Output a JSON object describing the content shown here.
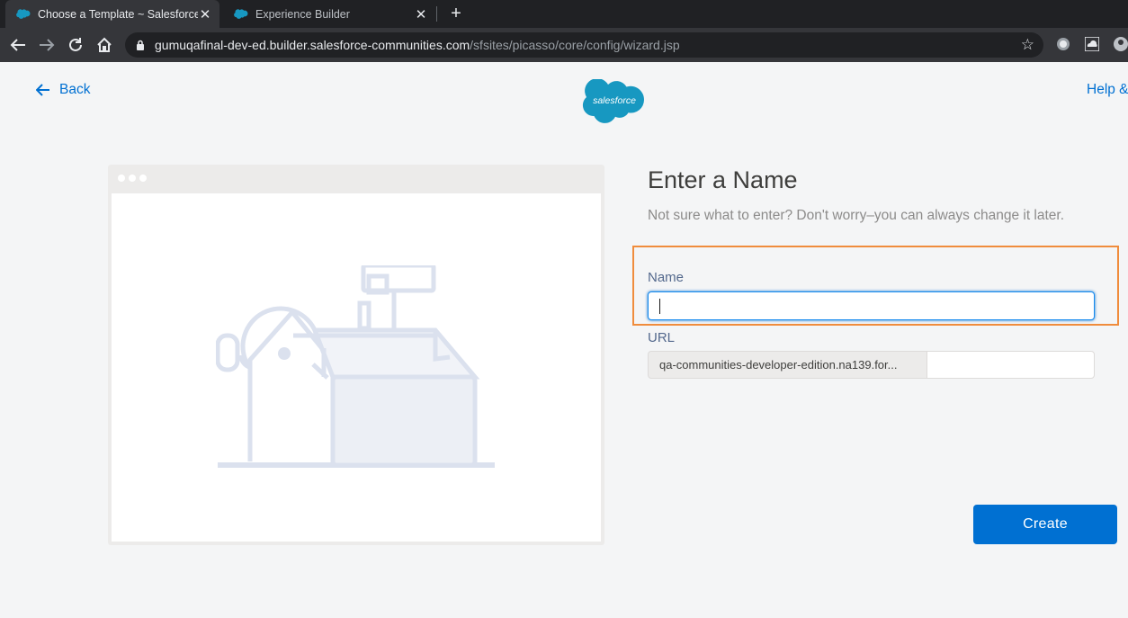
{
  "browser": {
    "tabs": [
      {
        "title": "Choose a Template ~ Salesforce -",
        "active": true
      },
      {
        "title": "Experience Builder",
        "active": false
      }
    ],
    "url_host": "gumuqafinal-dev-ed.builder.salesforce-communities.com",
    "url_path": "/sfsites/picasso/core/config/wizard.jsp"
  },
  "header": {
    "back_label": "Back",
    "logo_text": "salesforce",
    "help_label": "Help &"
  },
  "form": {
    "heading": "Enter a Name",
    "subtext": "Not sure what to enter? Don't worry–you can always change it later.",
    "name_label": "Name",
    "name_value": "",
    "url_label": "URL",
    "url_prefix": "qa-communities-developer-edition.na139.for...",
    "url_value": "",
    "create_label": "Create"
  },
  "colors": {
    "brand_blue": "#0070d2",
    "highlight_orange": "#f08c3c",
    "salesforce_cloud": "#1798c1"
  }
}
